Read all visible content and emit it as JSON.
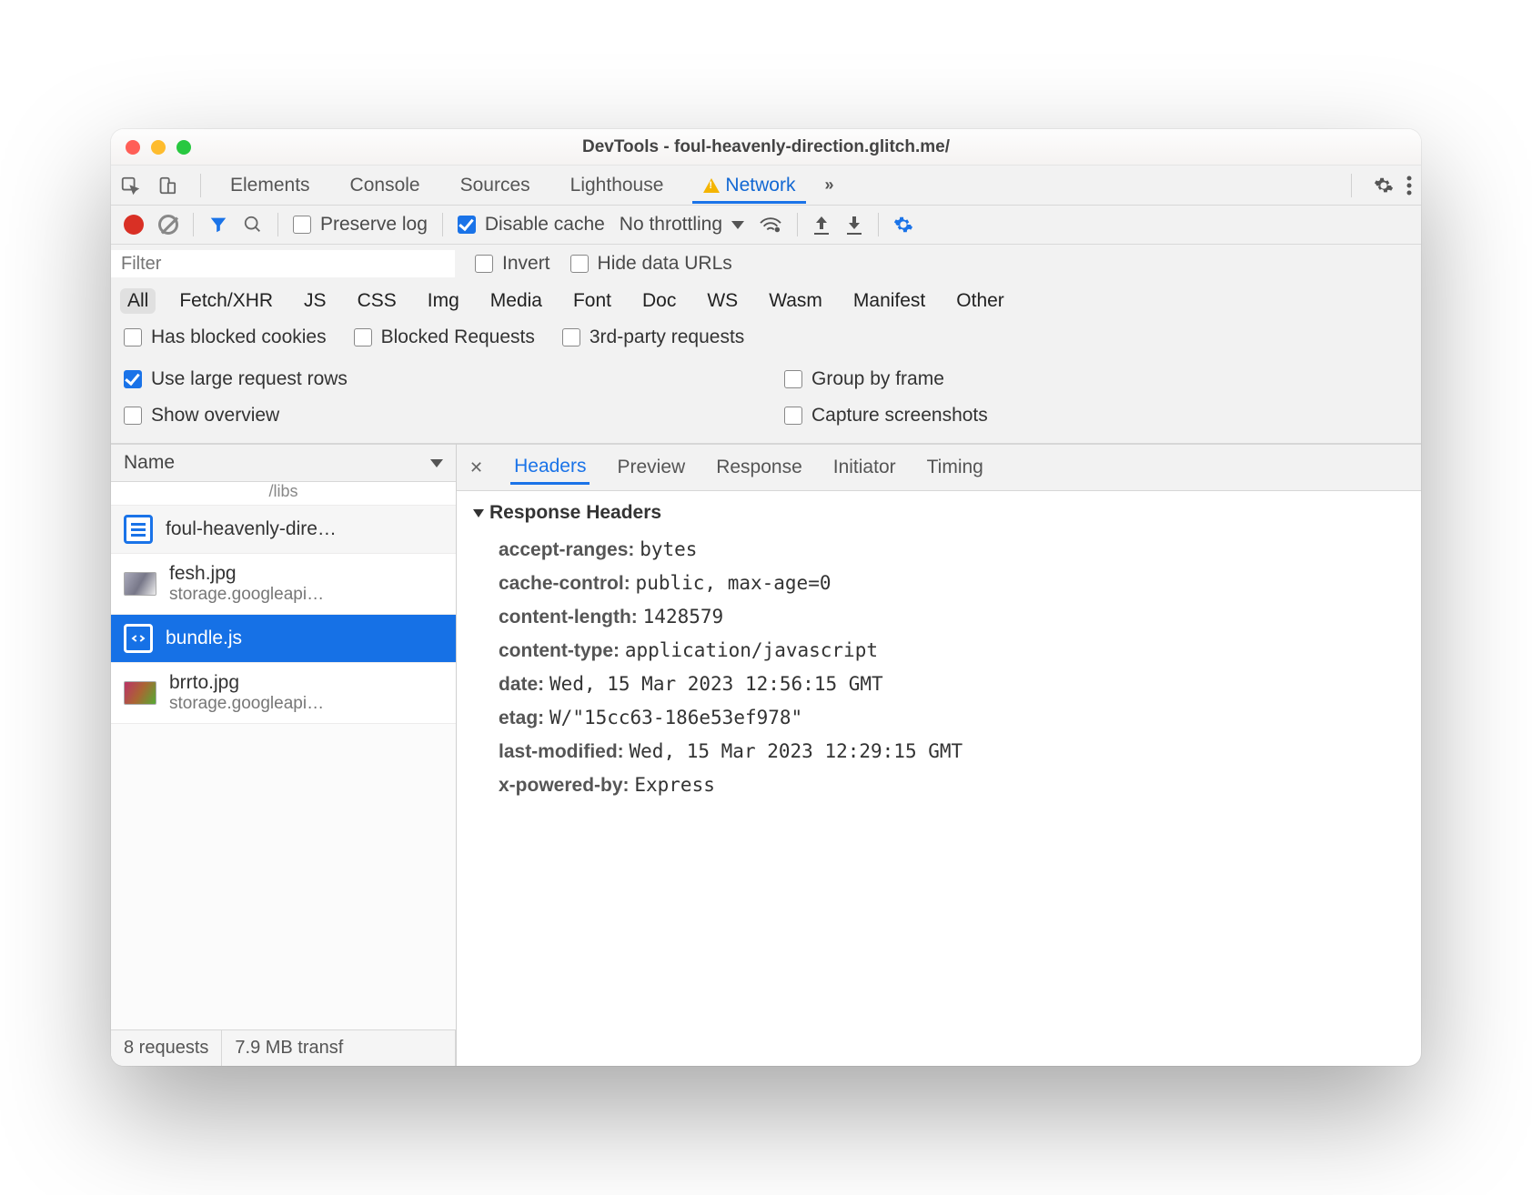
{
  "window": {
    "title": "DevTools - foul-heavenly-direction.glitch.me/"
  },
  "tabs": {
    "items": [
      "Elements",
      "Console",
      "Sources",
      "Lighthouse",
      "Network"
    ],
    "active_index": 4,
    "show_warning_on_active": true,
    "more_label": "»"
  },
  "toolbar": {
    "preserve_log_label": "Preserve log",
    "disable_cache_label": "Disable cache",
    "disable_cache_checked": true,
    "throttling_label": "No throttling"
  },
  "filter": {
    "placeholder": "Filter",
    "invert_label": "Invert",
    "hide_data_urls_label": "Hide data URLs"
  },
  "types": [
    "All",
    "Fetch/XHR",
    "JS",
    "CSS",
    "Img",
    "Media",
    "Font",
    "Doc",
    "WS",
    "Wasm",
    "Manifest",
    "Other"
  ],
  "types_selected_index": 0,
  "row_checks": {
    "has_blocked_cookies": "Has blocked cookies",
    "blocked_requests": "Blocked Requests",
    "third_party": "3rd-party requests"
  },
  "view_options": {
    "use_large_rows": {
      "label": "Use large request rows",
      "checked": true
    },
    "group_by_frame": {
      "label": "Group by frame",
      "checked": false
    },
    "show_overview": {
      "label": "Show overview",
      "checked": false
    },
    "capture_screenshots": {
      "label": "Capture screenshots",
      "checked": false
    }
  },
  "sidebar": {
    "header": "Name",
    "truncated_prev": "/libs",
    "rows": [
      {
        "name": "foul-heavenly-dire…",
        "sub": "",
        "icon": "doc"
      },
      {
        "name": "fesh.jpg",
        "sub": "storage.googleapi…",
        "icon": "img"
      },
      {
        "name": "bundle.js",
        "sub": "",
        "icon": "js",
        "selected": true
      },
      {
        "name": "brrto.jpg",
        "sub": "storage.googleapi…",
        "icon": "img2"
      }
    ],
    "footer": {
      "requests": "8 requests",
      "transfer": "7.9 MB transf"
    }
  },
  "details": {
    "tabs": [
      "Headers",
      "Preview",
      "Response",
      "Initiator",
      "Timing"
    ],
    "active_index": 0,
    "section": "Response Headers",
    "headers": [
      {
        "k": "accept-ranges:",
        "v": "bytes"
      },
      {
        "k": "cache-control:",
        "v": "public, max-age=0"
      },
      {
        "k": "content-length:",
        "v": "1428579"
      },
      {
        "k": "content-type:",
        "v": "application/javascript"
      },
      {
        "k": "date:",
        "v": "Wed, 15 Mar 2023 12:56:15 GMT"
      },
      {
        "k": "etag:",
        "v": "W/\"15cc63-186e53ef978\""
      },
      {
        "k": "last-modified:",
        "v": "Wed, 15 Mar 2023 12:29:15 GMT"
      },
      {
        "k": "x-powered-by:",
        "v": "Express"
      }
    ]
  }
}
